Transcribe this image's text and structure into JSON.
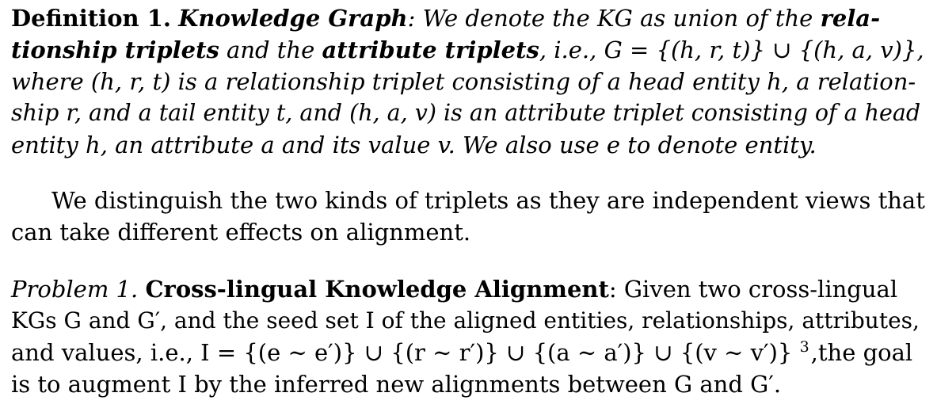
{
  "definition": {
    "label": "Definition 1.",
    "term": "Knowledge Graph",
    "lines": {
      "l1_rest": ": We denote the KG as union of the",
      "l1_bold": "rela-",
      "l2_bold_a": "tionship triplets",
      "l2_mid": " and the ",
      "l2_bold_b": "attribute triplets",
      "l2_rest": ", i.e., G = {(h, r, t)} ∪ {(h, a, v)},",
      "l3": "where (h, r, t) is a relationship triplet consisting of a head entity h, a relation-",
      "l4": "ship r, and a tail entity t, and (h, a, v) is an attribute triplet consisting of a head",
      "l5": "entity h, an attribute a and its value v. We also use e to denote entity."
    }
  },
  "paragraph": {
    "l1": "We distinguish the two kinds of triplets as they are independent views that",
    "l2": "can take different effects on alignment."
  },
  "problem": {
    "label": "Problem 1.",
    "title": "Cross-lingual Knowledge Alignment",
    "lines": {
      "l1_rest": ": Given two cross-lingual",
      "l2": "KGs G and G′, and the seed set I of the aligned entities, relationships, attributes,",
      "l3_main": "and values, i.e., I = {(e ∼ e′)} ∪ {(r ∼ r′)} ∪ {(a ∼ a′)} ∪ {(v ∼ v′)}",
      "l3_footnote": "3",
      "l3_rest": ",the goal",
      "l4": "is to augment I by the inferred new alignments between G and G′."
    }
  }
}
